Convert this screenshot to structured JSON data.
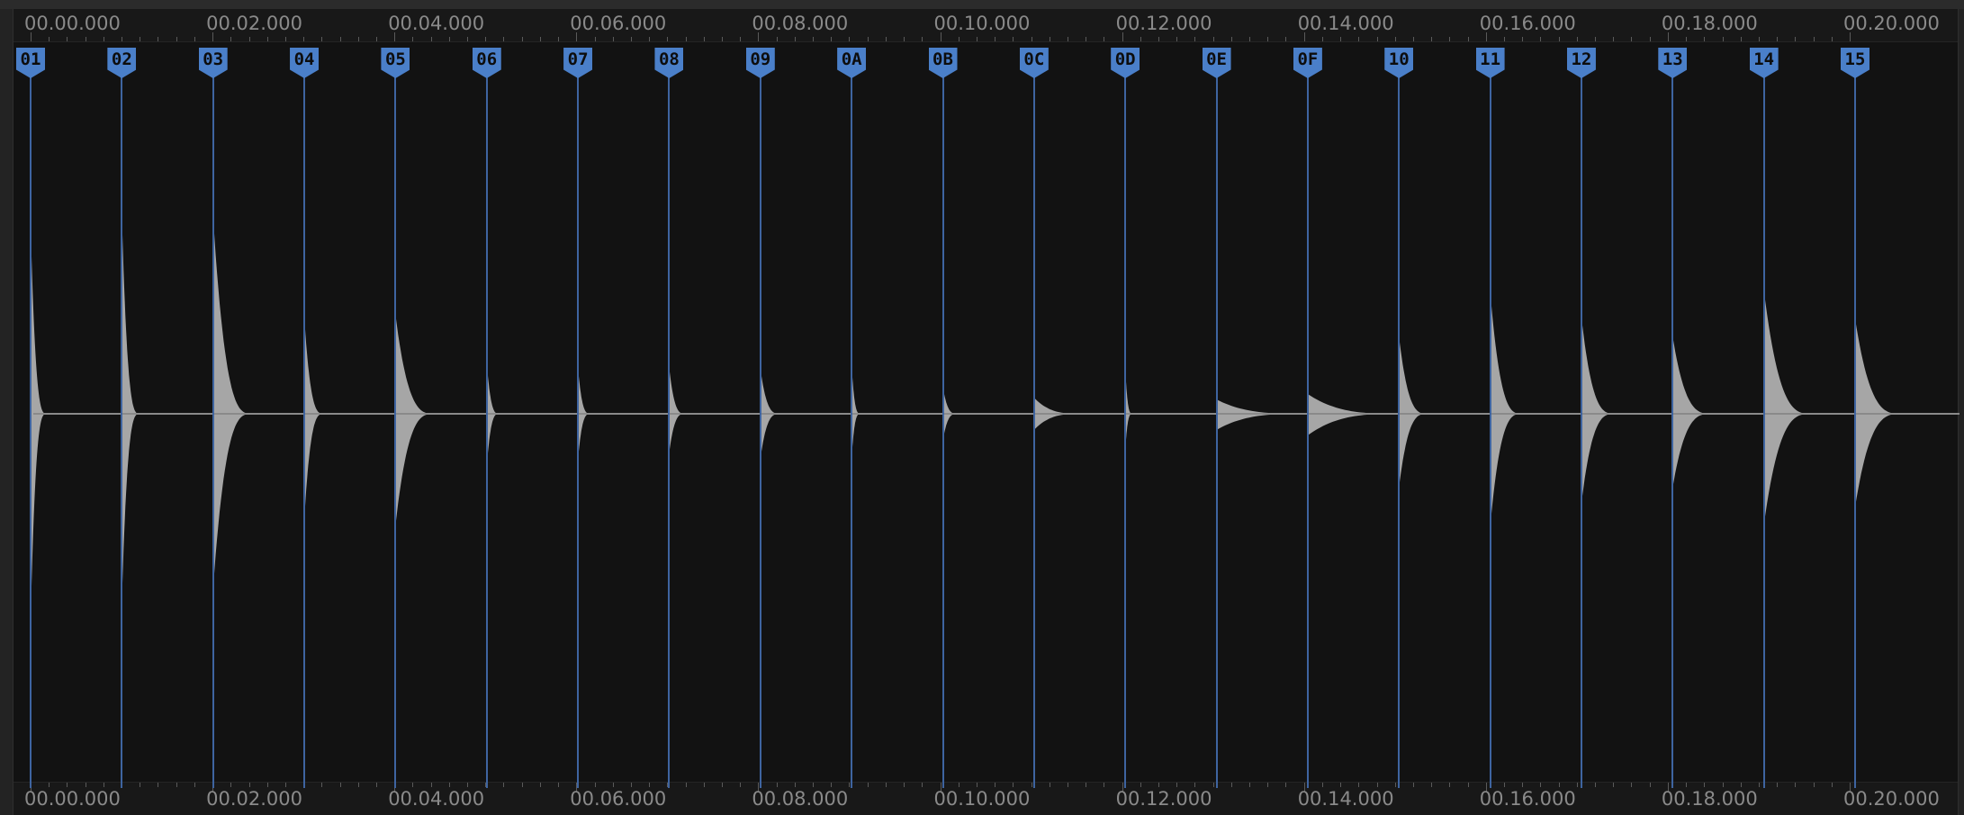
{
  "timeline": {
    "labels": [
      "00.00.000",
      "00.02.000",
      "00.04.000",
      "00.06.000",
      "00.08.000",
      "00.10.000",
      "00.12.000",
      "00.14.000",
      "00.16.000",
      "00.18.000",
      "00.20.000"
    ]
  },
  "markers": [
    "01",
    "02",
    "03",
    "04",
    "05",
    "06",
    "07",
    "08",
    "09",
    "0A",
    "0B",
    "0C",
    "0D",
    "0E",
    "0F",
    "10",
    "11",
    "12",
    "13",
    "14",
    "15"
  ],
  "colors": {
    "background": "#121212",
    "marker": "#4a7fc9",
    "marker_line": "#3e64a0",
    "waveform": "#a6a6a6",
    "ruler_text": "#8a8a8a"
  }
}
